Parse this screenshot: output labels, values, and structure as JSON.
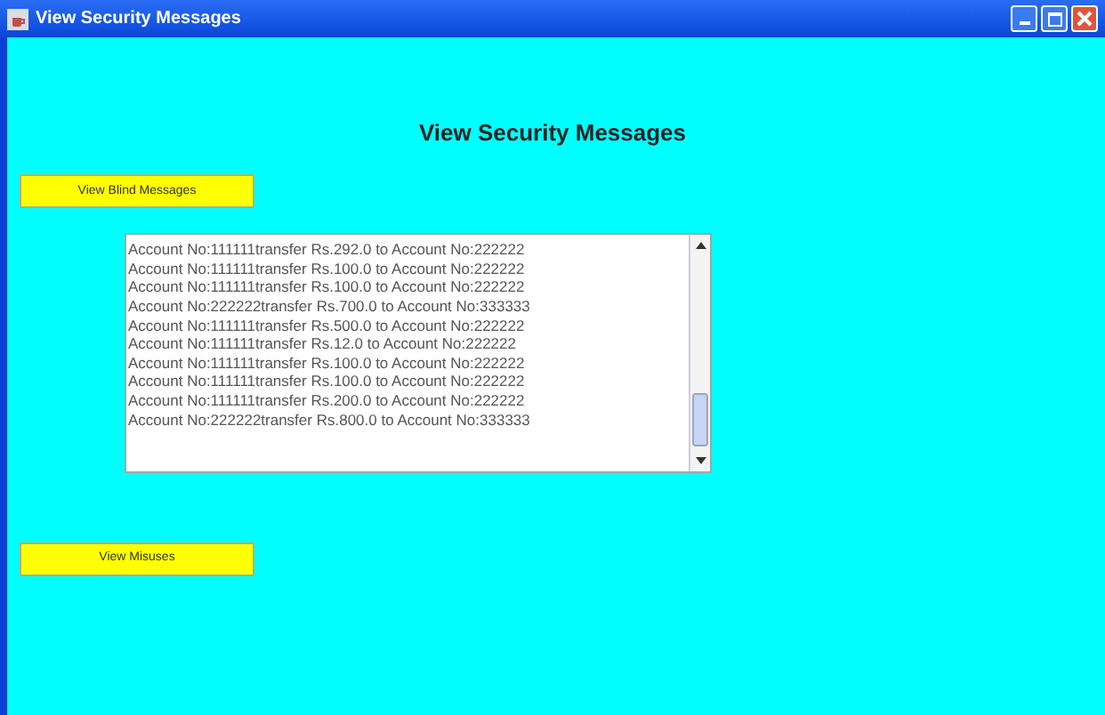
{
  "window": {
    "title": "View Security Messages"
  },
  "heading": "View Security Messages",
  "buttons": [
    {
      "label": "View Blind Messages"
    },
    {
      "label": "View Misuses"
    }
  ],
  "messages": [
    "Account No:111111transfer Rs.292.0 to Account No:222222",
    "Account No:111111transfer Rs.100.0 to Account No:222222",
    "Account No:111111transfer Rs.100.0 to Account No:222222",
    "Account No:222222transfer Rs.700.0 to Account No:333333",
    "Account No:111111transfer Rs.500.0 to Account No:222222",
    "Account No:111111transfer Rs.12.0 to Account No:222222",
    "Account No:111111transfer Rs.100.0 to Account No:222222",
    "Account No:111111transfer Rs.100.0 to Account No:222222",
    "Account No:111111transfer Rs.200.0 to Account No:222222",
    "Account No:222222transfer Rs.800.0 to Account No:333333"
  ]
}
